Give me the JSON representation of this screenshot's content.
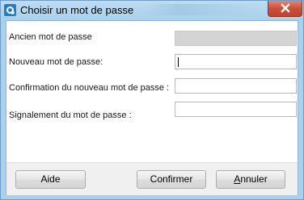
{
  "window": {
    "title": "Choisir un mot de passe",
    "app_icon": "app-logo-icon",
    "close_icon": "close-icon",
    "close_color": "#c7503c"
  },
  "form": {
    "old_password_label": "Ancien mot de passe",
    "new_password_label": "Nouveau mot de passe:",
    "confirm_password_label": "Confirmation du nouveau mot de passe :",
    "password_hint_label": "Signalement du mot de passe :"
  },
  "buttons": {
    "help_label": "Aide",
    "confirm_label": "Confirmer",
    "cancel_accel": "A",
    "cancel_rest": "nnuler"
  }
}
